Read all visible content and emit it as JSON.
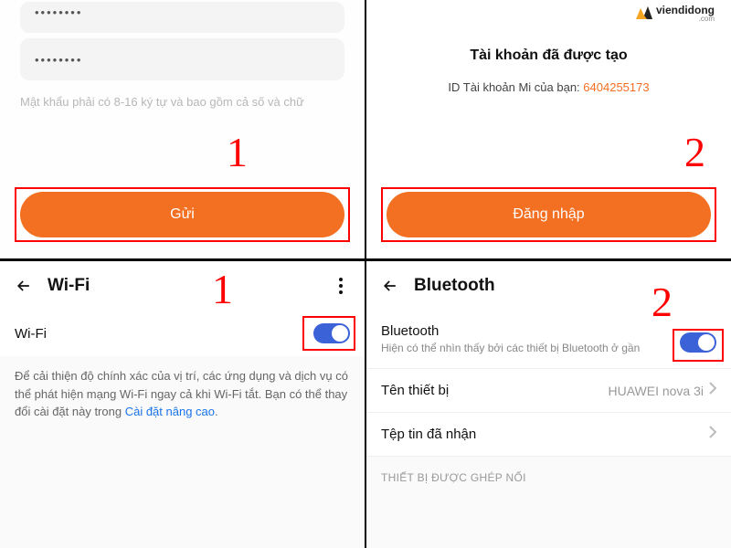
{
  "watermark": {
    "brand": "viendidong",
    "suffix": ".com"
  },
  "panel1": {
    "pw_mask1": "••••••••",
    "pw_mask2": "••••••••",
    "hint": "Mật khẩu phải có 8-16 ký tự và bao gồm cả số và chữ",
    "submit": "Gửi",
    "step": "1"
  },
  "panel2": {
    "title": "Tài khoản đã được tạo",
    "id_label": "ID Tài khoản Mi của bạn: ",
    "id_value": "6404255173",
    "login": "Đăng nhập",
    "step": "2"
  },
  "panel3": {
    "header": "Wi-Fi",
    "row_label": "Wi-Fi",
    "desc_pre": "Để cải thiện độ chính xác của vị trí, các ứng dụng và dịch vụ có thể phát hiện mạng Wi-Fi ngay cả khi Wi-Fi tắt. Bạn có thể thay đổi cài đặt này trong ",
    "desc_link": "Cài đặt nâng cao",
    "desc_post": ".",
    "step": "1"
  },
  "panel4": {
    "header": "Bluetooth",
    "bt_label": "Bluetooth",
    "bt_sub": "Hiện có thể nhìn thấy bởi các thiết bị Bluetooth ở gần",
    "device_label": "Tên thiết bị",
    "device_value": "HUAWEI nova 3i",
    "files_label": "Tệp tin đã nhận",
    "paired_label": "THIẾT BỊ ĐƯỢC GHÉP NỐI",
    "step": "2"
  }
}
